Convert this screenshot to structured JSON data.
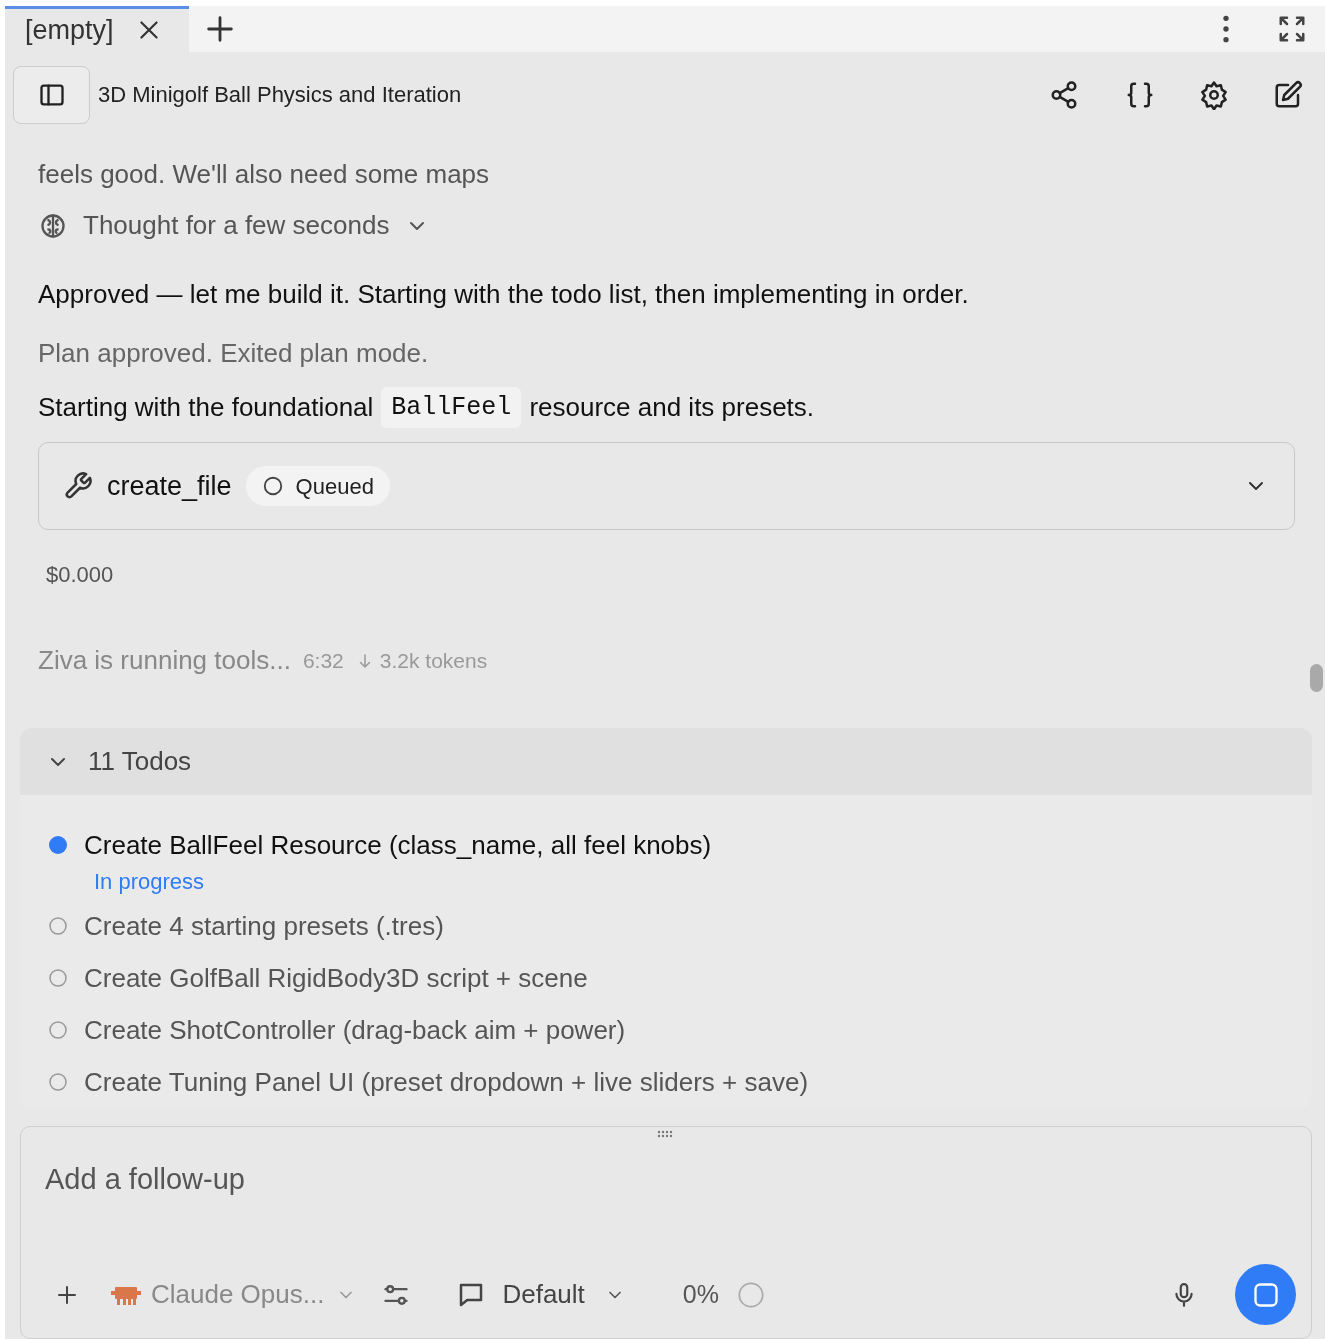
{
  "tabs": [
    {
      "label": "[empty]",
      "selected": true
    }
  ],
  "header": {
    "title": "3D Minigolf Ball Physics and Iteration"
  },
  "user_message": {
    "lines": [
      "feels good. We'll also need some maps"
    ]
  },
  "thought": {
    "label": "Thought for a few seconds",
    "expanded": false
  },
  "assistant_text": "Approved — let me build it. Starting with the todo list, then implementing in order.",
  "status_note": "Plan approved. Exited plan mode.",
  "intro": {
    "before": "Starting with the foundational",
    "code": "BallFeel",
    "after": "resource and its presets."
  },
  "tool_call": {
    "name": "create_file",
    "status": "Queued",
    "expanded": false
  },
  "cost": "$0.000",
  "activity": {
    "text": "Ziva is running tools...",
    "elapsed": "6:32",
    "tokens": "3.2k tokens"
  },
  "todos": {
    "title": "11 Todos",
    "expanded": true,
    "items": [
      {
        "text": "Create BallFeel Resource (class_name, all feel knobs)",
        "kind": "active",
        "status_label": "In progress"
      },
      {
        "text": "Create 4 starting presets (.tres)",
        "kind": "pending"
      },
      {
        "text": "Create GolfBall RigidBody3D script + scene",
        "kind": "pending"
      },
      {
        "text": "Create ShotController (drag-back aim + power)",
        "kind": "pending"
      },
      {
        "text": "Create Tuning Panel UI (preset dropdown + live sliders + save)",
        "kind": "pending"
      }
    ]
  },
  "composer": {
    "placeholder": "Add a follow-up",
    "model": "Claude Opus...",
    "mode": "Default",
    "context": "0%"
  }
}
